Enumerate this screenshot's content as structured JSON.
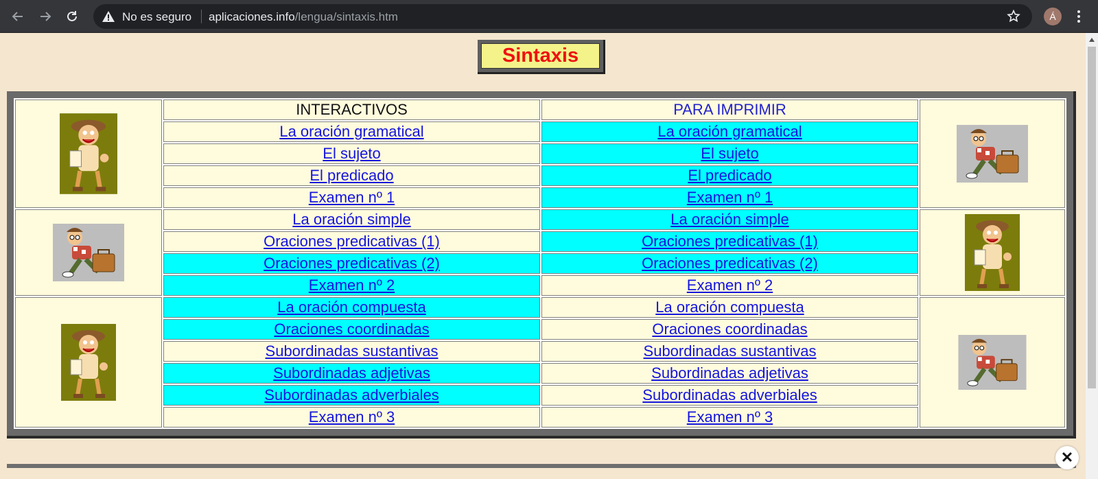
{
  "browser": {
    "security_label": "No es seguro",
    "url_host": "aplicaciones.info",
    "url_path": "/lengua/sintaxis.htm",
    "avatar_initial": "Á"
  },
  "page": {
    "title": "Sintaxis",
    "headers": {
      "interactive": "INTERACTIVOS",
      "print": "PARA IMPRIMIR"
    },
    "rows": [
      {
        "interactive": "La oración gramatical",
        "print": "La oración gramatical",
        "int_highlight": false,
        "print_highlight": true
      },
      {
        "interactive": "El sujeto",
        "print": "El sujeto",
        "int_highlight": false,
        "print_highlight": true
      },
      {
        "interactive": "El predicado",
        "print": "El predicado",
        "int_highlight": false,
        "print_highlight": true
      },
      {
        "interactive": "Examen nº 1",
        "print": "Examen nº 1",
        "int_highlight": false,
        "print_highlight": true
      },
      {
        "interactive": "La oración simple",
        "print": "La oración simple",
        "int_highlight": false,
        "print_highlight": true
      },
      {
        "interactive": "Oraciones predicativas (1)",
        "print": "Oraciones predicativas (1)",
        "int_highlight": false,
        "print_highlight": true
      },
      {
        "interactive": "Oraciones predicativas (2)",
        "print": "Oraciones predicativas (2)",
        "int_highlight": true,
        "print_highlight": true
      },
      {
        "interactive": "Examen nº 2",
        "print": "Examen nº 2",
        "int_highlight": true,
        "print_highlight": false
      },
      {
        "interactive": "La oración compuesta",
        "print": "La oración compuesta",
        "int_highlight": true,
        "print_highlight": false
      },
      {
        "interactive": "Oraciones coordinadas",
        "print": "Oraciones coordinadas",
        "int_highlight": true,
        "print_highlight": false
      },
      {
        "interactive": "Subordinadas sustantivas",
        "print": "Subordinadas sustantivas",
        "int_highlight": false,
        "print_highlight": false
      },
      {
        "interactive": "Subordinadas adjetivas",
        "print": "Subordinadas adjetivas",
        "int_highlight": true,
        "print_highlight": false
      },
      {
        "interactive": "Subordinadas adverbiales",
        "print": "Subordinadas adverbiales",
        "int_highlight": true,
        "print_highlight": false
      },
      {
        "interactive": "Examen nº 3",
        "print": "Examen nº 3",
        "int_highlight": false,
        "print_highlight": false
      }
    ]
  },
  "colors": {
    "highlight": "#00ffff",
    "cell_bg": "#fffbdd",
    "link": "#1515dd",
    "title_text": "#ee1111",
    "title_bg": "#f3f38a",
    "page_bg": "#f5e6cf"
  },
  "icons": {
    "back": "arrow-left-icon",
    "forward": "arrow-right-icon",
    "reload": "reload-icon",
    "warning": "warning-triangle-icon",
    "bookmark": "star-icon",
    "menu": "kebab-menu-icon",
    "close": "close-icon",
    "figure_a": "cartoon-character-standing-icon",
    "figure_b": "cartoon-character-with-briefcase-icon"
  }
}
